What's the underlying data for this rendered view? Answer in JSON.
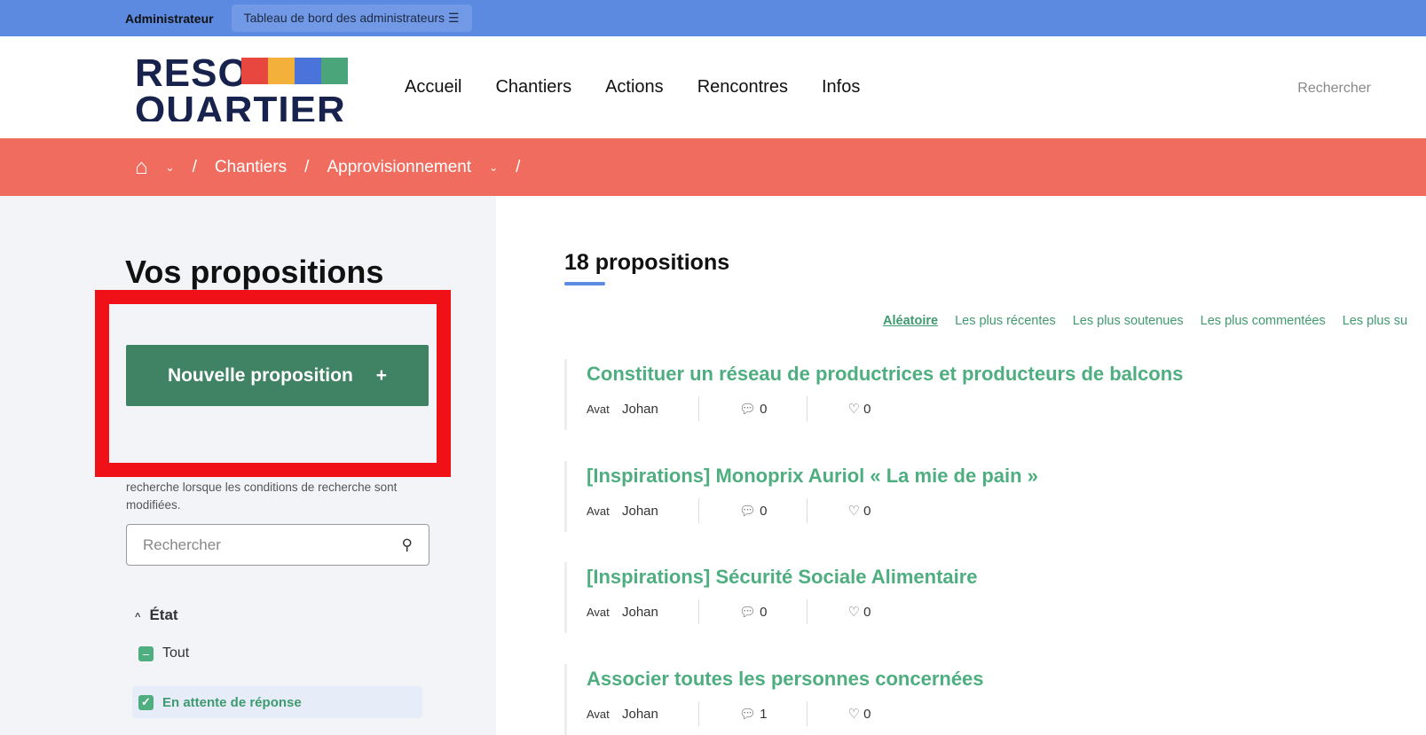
{
  "admin_bar": {
    "role": "Administrateur",
    "dashboard": "Tableau de bord des administrateurs"
  },
  "logo": {
    "line1": "RESO",
    "line2": "QUARTIER",
    "colors": [
      "#e8473f",
      "#f3b03b",
      "#4a74d9",
      "#4aa57a"
    ]
  },
  "nav": [
    "Accueil",
    "Chantiers",
    "Actions",
    "Rencontres",
    "Infos"
  ],
  "header_search": "Rechercher",
  "breadcrumb": {
    "items": [
      "Chantiers",
      "Approvisionnement"
    ]
  },
  "sidebar": {
    "title": "Vos propositions",
    "new_button": "Nouvelle proposition",
    "help": "Le formulaire ci-dessous filtre les résultats de la recherche lorsque les conditions de recherche sont modifiées.",
    "search_placeholder": "Rechercher",
    "filter_title": "État",
    "filters": [
      {
        "label": "Tout",
        "state": "indeterminate"
      },
      {
        "label": "En attente de réponse",
        "state": "checked"
      }
    ]
  },
  "main": {
    "count": "18 propositions",
    "sort": [
      "Aléatoire",
      "Les plus récentes",
      "Les plus soutenues",
      "Les plus commentées",
      "Les plus su"
    ],
    "proposals": [
      {
        "title": "Constituer un réseau de productrices et producteurs de balcons",
        "avatar": "Avat",
        "author": "Johan",
        "comments": "0",
        "supports": "0"
      },
      {
        "title": "[Inspirations] Monoprix Auriol « La mie de pain »",
        "avatar": "Avat",
        "author": "Johan",
        "comments": "0",
        "supports": "0"
      },
      {
        "title": "[Inspirations] Sécurité Sociale Alimentaire",
        "avatar": "Avat",
        "author": "Johan",
        "comments": "0",
        "supports": "0"
      },
      {
        "title": "Associer toutes les personnes concernées",
        "avatar": "Avat",
        "author": "Johan",
        "comments": "1",
        "supports": "0"
      }
    ]
  },
  "colors": {
    "admin_bar": "#5b8ae0",
    "breadcrumb": "#f06c5e",
    "primary": "#3f8264",
    "link": "#4fae80",
    "highlight": "#f01018"
  }
}
